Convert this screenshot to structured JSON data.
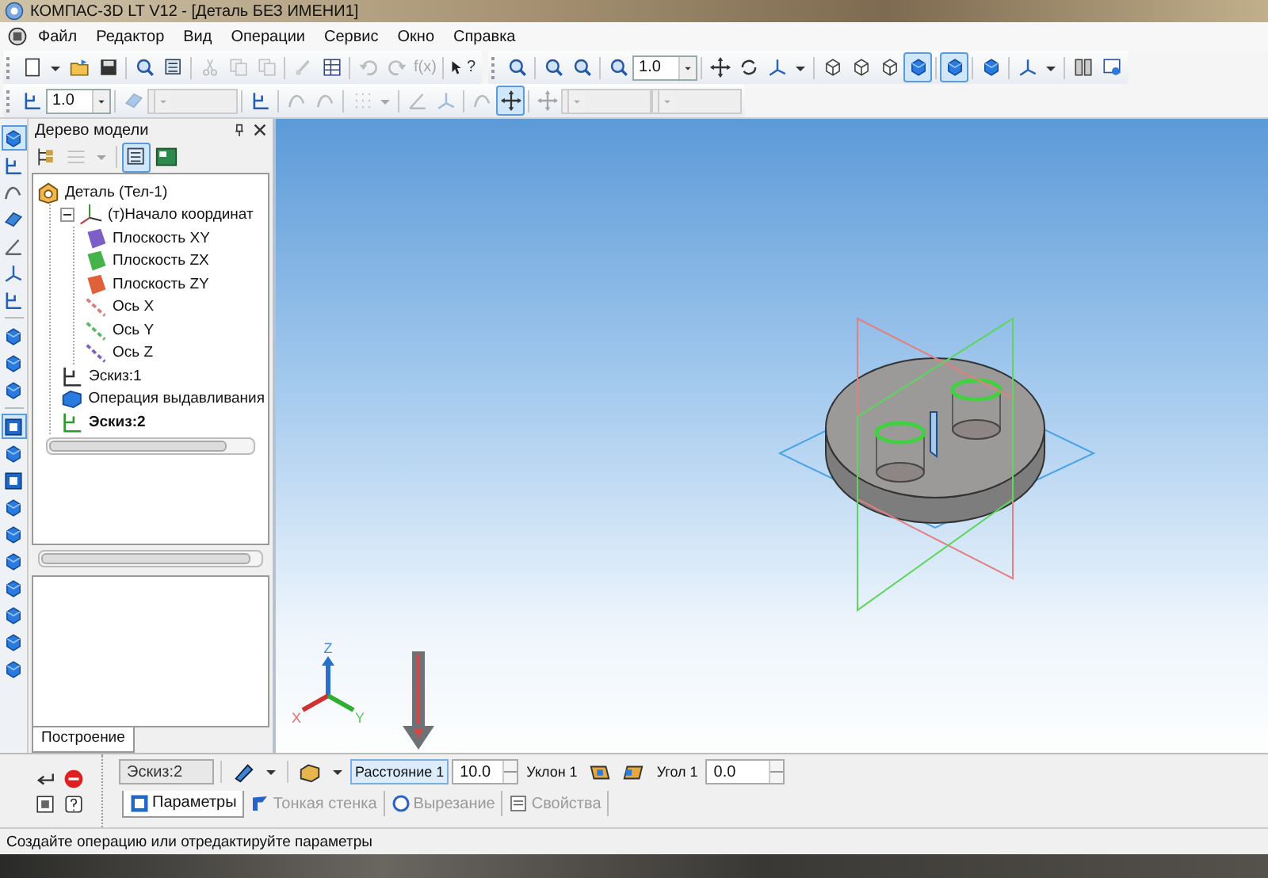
{
  "window": {
    "title": "КОМПАС-3D LT V12 - [Деталь БЕЗ ИМЕНИ1]"
  },
  "menu": [
    "Файл",
    "Редактор",
    "Вид",
    "Операции",
    "Сервис",
    "Окно",
    "Справка"
  ],
  "toolbar_rows": [
    {
      "groups": [
        [
          {
            "kind": "new",
            "pressed": false
          },
          {
            "kind": "caret",
            "pressed": false
          },
          {
            "kind": "open",
            "pressed": false
          },
          {
            "kind": "save",
            "pressed": false
          },
          {
            "kind": "sep"
          },
          {
            "kind": "preview",
            "pressed": false
          },
          {
            "kind": "sheet",
            "pressed": false
          },
          {
            "kind": "sep"
          },
          {
            "kind": "cut",
            "pressed": false,
            "disabled": true
          },
          {
            "kind": "copy",
            "pressed": false,
            "disabled": true
          },
          {
            "kind": "paste",
            "pressed": false,
            "disabled": true
          },
          {
            "kind": "sep"
          },
          {
            "kind": "brush",
            "pressed": false,
            "disabled": true
          },
          {
            "kind": "table",
            "pressed": false
          },
          {
            "kind": "sep"
          },
          {
            "kind": "undo",
            "pressed": false,
            "disabled": true
          },
          {
            "kind": "redo",
            "pressed": false,
            "disabled": true
          },
          {
            "kind": "text",
            "label": "f(x)",
            "pressed": false,
            "disabled": true
          },
          {
            "kind": "sep"
          },
          {
            "kind": "help",
            "label": "?",
            "pressed": false
          }
        ],
        [
          {
            "kind": "zoom",
            "pressed": false
          },
          {
            "kind": "sep"
          },
          {
            "kind": "zoom-window",
            "pressed": false
          },
          {
            "kind": "zoom-in",
            "pressed": false
          },
          {
            "kind": "sep"
          },
          {
            "kind": "zoom-scale",
            "pressed": false
          },
          {
            "kind": "field",
            "value": "1.0"
          },
          {
            "kind": "sep"
          },
          {
            "kind": "pan",
            "pressed": false
          },
          {
            "kind": "rotate",
            "pressed": false
          },
          {
            "kind": "axes",
            "pressed": false
          },
          {
            "kind": "caret",
            "pressed": false
          },
          {
            "kind": "sep"
          },
          {
            "kind": "wireframe",
            "pressed": false
          },
          {
            "kind": "hidden",
            "pressed": false
          },
          {
            "kind": "thin",
            "pressed": false
          },
          {
            "kind": "shaded",
            "pressed": true
          },
          {
            "kind": "sep"
          },
          {
            "kind": "shaded-edges",
            "pressed": true
          },
          {
            "kind": "sep"
          },
          {
            "kind": "perspective",
            "pressed": false
          },
          {
            "kind": "sep"
          },
          {
            "kind": "orient",
            "pressed": false
          },
          {
            "kind": "caret",
            "pressed": false
          },
          {
            "kind": "sep"
          },
          {
            "kind": "panels",
            "pressed": false
          },
          {
            "kind": "refresh",
            "pressed": false
          }
        ]
      ]
    },
    {
      "groups": [
        [
          {
            "kind": "snap",
            "pressed": false
          },
          {
            "kind": "field",
            "value": "1.0"
          },
          {
            "kind": "sep"
          },
          {
            "kind": "plane",
            "pressed": false,
            "disabled": true
          },
          {
            "kind": "field",
            "disabled": true
          },
          {
            "kind": "sep"
          },
          {
            "kind": "sketch",
            "pressed": false
          },
          {
            "kind": "sep"
          },
          {
            "kind": "curve",
            "pressed": false,
            "disabled": true
          },
          {
            "kind": "curve",
            "pressed": false,
            "disabled": true
          },
          {
            "kind": "sep"
          },
          {
            "kind": "grid",
            "pressed": false,
            "disabled": true
          },
          {
            "kind": "caret",
            "pressed": false,
            "disabled": true
          },
          {
            "kind": "sep"
          },
          {
            "kind": "angle",
            "pressed": false,
            "disabled": true
          },
          {
            "kind": "axes",
            "pressed": false,
            "disabled": true
          },
          {
            "kind": "sep"
          },
          {
            "kind": "spline",
            "pressed": false,
            "disabled": true
          },
          {
            "kind": "snap-pair",
            "pressed": true
          },
          {
            "kind": "sep"
          },
          {
            "kind": "xy",
            "pressed": false,
            "disabled": true
          },
          {
            "kind": "field",
            "disabled": true
          },
          {
            "kind": "field",
            "disabled": true
          }
        ]
      ]
    }
  ],
  "left_toolbar": [
    {
      "kind": "cube",
      "pressed": true
    },
    {
      "kind": "sketch",
      "pressed": false
    },
    {
      "kind": "curve",
      "pressed": false
    },
    {
      "kind": "plane",
      "pressed": false
    },
    {
      "kind": "angle",
      "pressed": false
    },
    {
      "kind": "axes",
      "pressed": false
    },
    {
      "kind": "snap",
      "pressed": false
    },
    {
      "kind": "sep"
    },
    {
      "kind": "cube",
      "pressed": false
    },
    {
      "kind": "cube",
      "pressed": false
    },
    {
      "kind": "cube",
      "pressed": false
    },
    {
      "kind": "sep"
    },
    {
      "kind": "square",
      "pressed": true
    },
    {
      "kind": "cube",
      "pressed": false
    },
    {
      "kind": "square",
      "pressed": false
    },
    {
      "kind": "cube",
      "pressed": false
    },
    {
      "kind": "cube",
      "pressed": false
    },
    {
      "kind": "cube",
      "pressed": false
    },
    {
      "kind": "cube",
      "pressed": false
    },
    {
      "kind": "cube",
      "pressed": false
    },
    {
      "kind": "cube",
      "pressed": false
    },
    {
      "kind": "cube",
      "pressed": false
    }
  ],
  "model_tree": {
    "title": "Дерево модели",
    "items": [
      {
        "label": "Деталь (Тел-1)",
        "kind": "part",
        "selected": false,
        "children": [
          {
            "label": "(т)Начало координат",
            "kind": "origin",
            "selected": false,
            "expanded": true,
            "children": [
              {
                "label": "Плоскость XY",
                "kind": "plane",
                "color": "#7b5fc7",
                "selected": false
              },
              {
                "label": "Плоскость ZX",
                "kind": "plane",
                "color": "#45b34a",
                "selected": false
              },
              {
                "label": "Плоскость ZY",
                "kind": "plane",
                "color": "#e0603a",
                "selected": false
              },
              {
                "label": "Ось X",
                "kind": "axis",
                "color": "#e07a7a",
                "selected": false
              },
              {
                "label": "Ось Y",
                "kind": "axis",
                "color": "#5cb85c",
                "selected": false
              },
              {
                "label": "Ось Z",
                "kind": "axis",
                "color": "#7f60c0",
                "selected": false
              }
            ]
          },
          {
            "label": "Эскиз:1",
            "kind": "sketch",
            "selected": false
          },
          {
            "label": "Операция выдавливания",
            "kind": "extrude",
            "selected": false
          },
          {
            "label": "Эскиз:2",
            "kind": "sketch",
            "selected": true
          }
        ]
      }
    ],
    "tabs": [
      {
        "label": "Построение",
        "selected": true
      }
    ]
  },
  "viewport": {
    "axis_labels": [
      "X",
      "Y",
      "Z"
    ]
  },
  "property_panel": {
    "object": "Эскиз:2",
    "distance": {
      "label": "Расстояние 1",
      "value": "10.0",
      "selected": true
    },
    "draft": {
      "label": "Уклон 1"
    },
    "angle": {
      "label": "Угол 1",
      "value": "0.0"
    },
    "tabs": [
      {
        "label": "Параметры",
        "selected": true,
        "disabled": false
      },
      {
        "label": "Тонкая стенка",
        "selected": false,
        "disabled": true
      },
      {
        "label": "Вырезание",
        "selected": false,
        "disabled": true
      },
      {
        "label": "Свойства",
        "selected": false,
        "disabled": true
      }
    ]
  },
  "status_bar": "Создайте операцию или отредактируйте параметры"
}
